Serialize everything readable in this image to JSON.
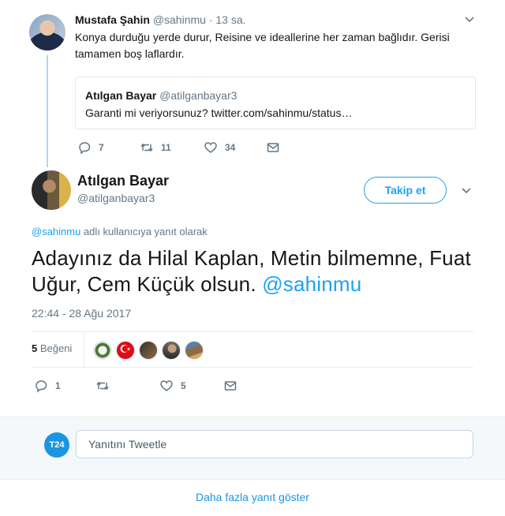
{
  "tweet1": {
    "name": "Mustafa Şahin",
    "handle": "@sahinmu",
    "separator": "·",
    "time": "13 sa.",
    "text": "Konya durduğu yerde durur, Reisine ve ideallerine her zaman bağlıdır. Gerisi tamamen boş laflardır.",
    "quote": {
      "name": "Atılgan Bayar",
      "handle": "@atilganbayar3",
      "text": "Garanti mi veriyorsunuz? twitter.com/sahinmu/status…"
    },
    "actions": {
      "replies": "7",
      "retweets": "11",
      "likes": "34"
    }
  },
  "tweet2": {
    "name": "Atılgan Bayar",
    "handle": "@atilganbayar3",
    "follow_label": "Takip et",
    "reply_to_mention": "@sahinmu",
    "reply_to_suffix": " adlı kullanıcıya yanıt olarak",
    "text_main": "Adayınız da Hilal Kaplan, Metin bilmemne, Fuat Uğur, Cem Küçük olsun. ",
    "text_mention": "@sahinmu",
    "datetime": "22:44 - 28 Ağu 2017",
    "likes_count": "5",
    "likes_label": " Beğeni",
    "actions": {
      "replies": "1",
      "retweets": "",
      "likes": "5"
    }
  },
  "reply_box": {
    "avatar_text": "T24",
    "placeholder": "Yanıtını Tweetle"
  },
  "more_replies": "Daha fazla yanıt göster",
  "colors": {
    "accent": "#1da1f2",
    "link": "#1b95e0",
    "muted": "#657786",
    "thread_line": "#a6d9f7"
  },
  "icons": [
    "chevron-down-icon",
    "reply-icon",
    "retweet-icon",
    "like-icon",
    "direct-message-icon",
    "turkish-flag-icon"
  ]
}
